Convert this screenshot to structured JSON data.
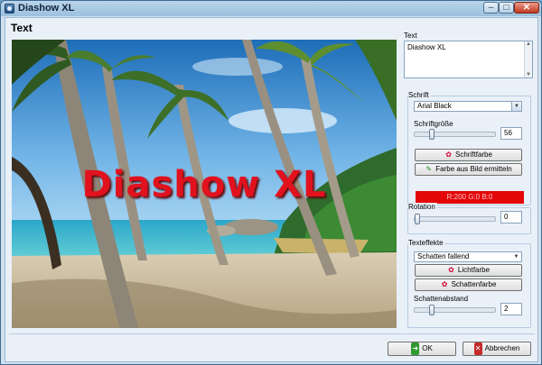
{
  "window": {
    "title": "Diashow XL",
    "min_glyph": "–",
    "max_glyph": "□",
    "close_glyph": "✕"
  },
  "page": {
    "heading": "Text"
  },
  "preview": {
    "overlay_text": "Diashow XL",
    "overlay_color": "#e1121e"
  },
  "text_section": {
    "label": "Text",
    "value": "Diashow XL"
  },
  "font": {
    "group_label": "Schrift",
    "family": "Arial Black",
    "size_label": "Schriftgröße",
    "size_value": "56",
    "color_button": "Schriftfarbe",
    "pick_button": "Farbe aus Bild ermitteln",
    "color_readout": "R:200  G:0  B:0",
    "color_hex": "#e4070a"
  },
  "rotation": {
    "label": "Rotation",
    "value": "0"
  },
  "effects": {
    "group_label": "Texteffekte",
    "shadow_mode": "Schatten fallend",
    "light_button": "Lichtfarbe",
    "shadow_button": "Schattenfarbe",
    "distance_label": "Schattenabstand",
    "distance_value": "2"
  },
  "footer": {
    "ok": "OK",
    "cancel": "Abbrechen"
  }
}
